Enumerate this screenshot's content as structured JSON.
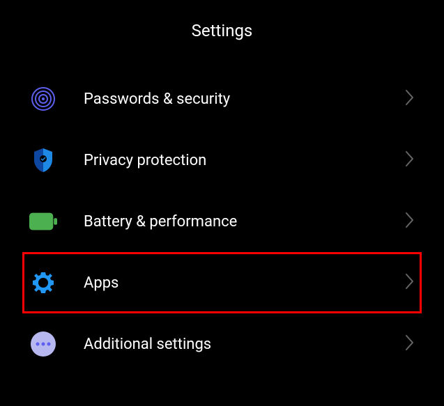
{
  "header": {
    "title": "Settings"
  },
  "menu": {
    "items": [
      {
        "label": "Passwords & security",
        "icon": "fingerprint-icon",
        "highlighted": false
      },
      {
        "label": "Privacy protection",
        "icon": "shield-icon",
        "highlighted": false
      },
      {
        "label": "Battery & performance",
        "icon": "battery-icon",
        "highlighted": false
      },
      {
        "label": "Apps",
        "icon": "gear-icon",
        "highlighted": true
      },
      {
        "label": "Additional settings",
        "icon": "more-icon",
        "highlighted": false
      }
    ]
  },
  "colors": {
    "fingerprint": "#5d5fef",
    "shield": "#1e88e5",
    "battery": "#4caf50",
    "gear": "#2196f3",
    "more": "#b8b8f0"
  }
}
